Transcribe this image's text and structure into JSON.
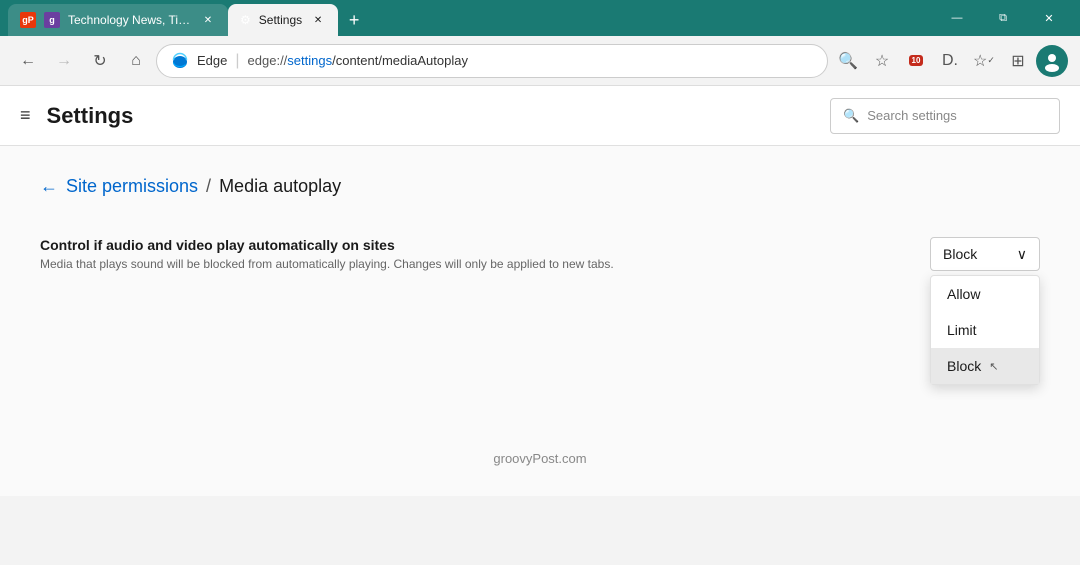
{
  "titlebar": {
    "tabs": [
      {
        "id": "tab-news",
        "favicon_type": "gp",
        "favicon_label": "gP",
        "label": "Technology News, Tips, Reviews.",
        "active": false,
        "show_close": true
      },
      {
        "id": "tab-settings",
        "favicon_type": "settings",
        "favicon_label": "⚙",
        "label": "Settings",
        "active": true,
        "show_close": true
      }
    ],
    "new_tab_label": "+",
    "controls": {
      "minimize": "—",
      "restore": "⧉",
      "close": "✕"
    }
  },
  "addressbar": {
    "back_title": "←",
    "forward_title": "→",
    "refresh_title": "↻",
    "home_title": "⌂",
    "edge_label": "Edge",
    "address_divider": "|",
    "protocol": "edge://",
    "path": "settings",
    "path_suffix": "/content/mediaAutoplay",
    "full_url": "edge://settings/content/mediaAutoplay",
    "search_icon": "🔍",
    "fav_icon": "☆",
    "collections_icon": "📋",
    "profile_icon": "👤",
    "badge_count": "10"
  },
  "settings": {
    "menu_icon": "≡",
    "title": "Settings",
    "search_placeholder": "Search settings",
    "search_icon": "🔍"
  },
  "breadcrumb": {
    "back_arrow": "←",
    "parent_label": "Site permissions",
    "separator": "/",
    "current_label": "Media autoplay"
  },
  "content": {
    "setting_label": "Control if audio and video play automatically on sites",
    "setting_desc": "Media that plays sound will be blocked from automatically playing. Changes will only be applied to new tabs.",
    "dropdown": {
      "selected": "Block",
      "chevron": "∨",
      "options": [
        {
          "label": "Allow",
          "value": "allow",
          "selected": false
        },
        {
          "label": "Limit",
          "value": "limit",
          "selected": false
        },
        {
          "label": "Block",
          "value": "block",
          "selected": true
        }
      ]
    }
  },
  "footer": {
    "text": "groovyPost.com"
  }
}
